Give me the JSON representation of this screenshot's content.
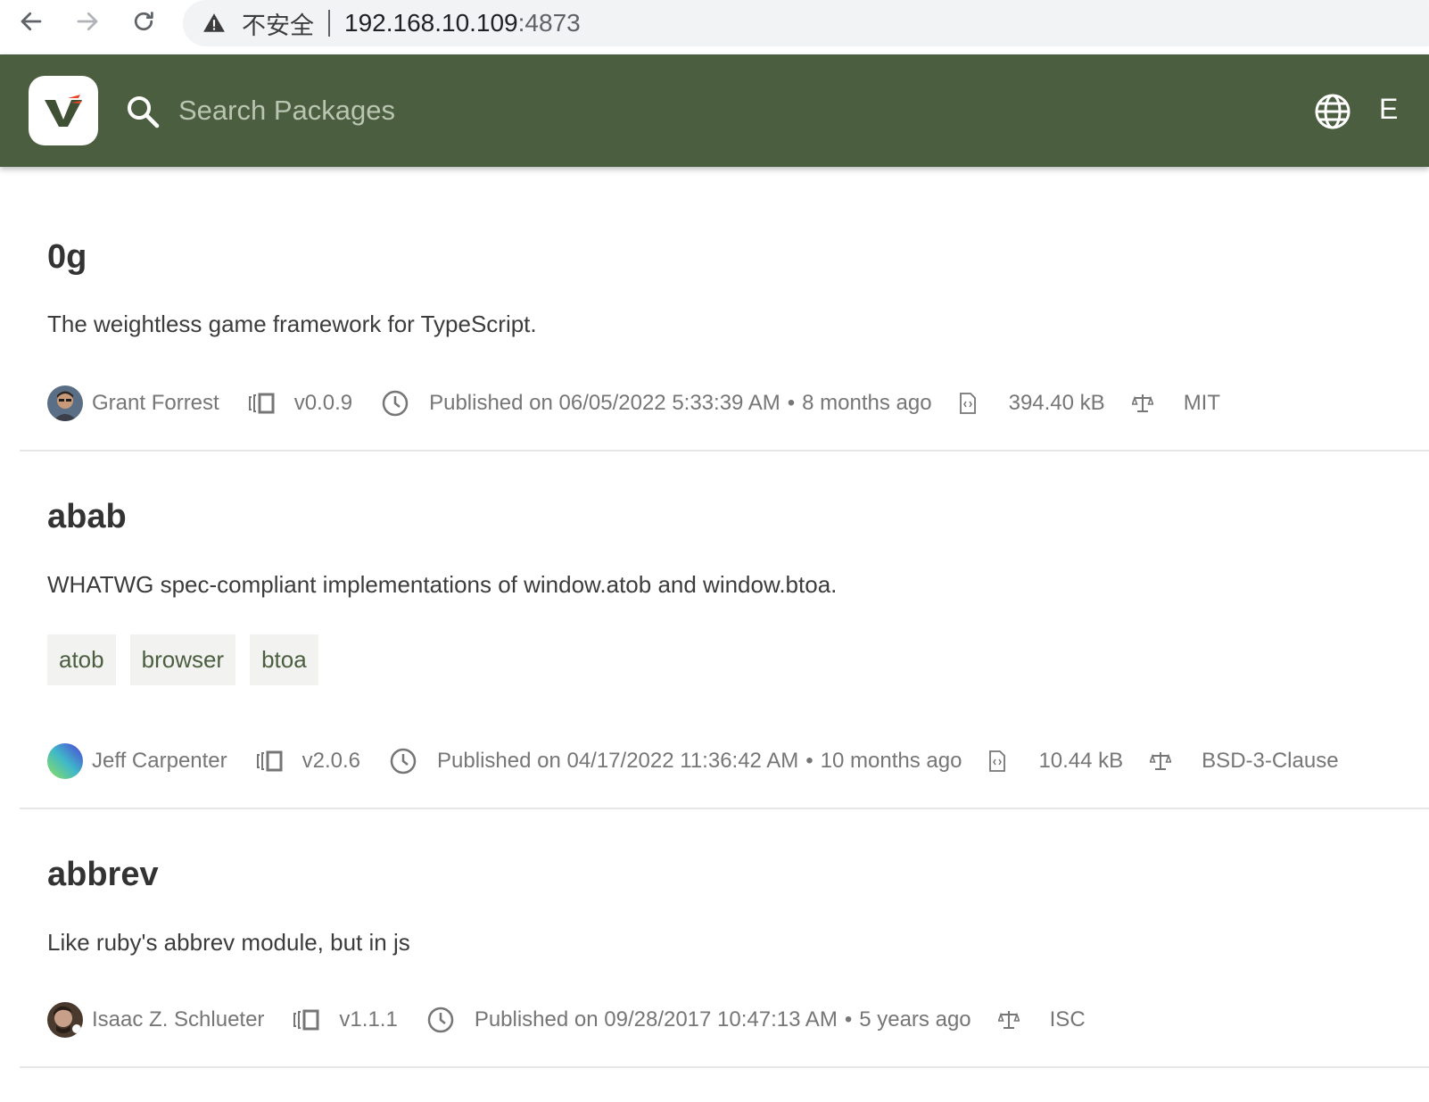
{
  "browser": {
    "insecure_label": "不安全",
    "url_host": "192.168.10.109",
    "url_port": ":4873"
  },
  "header": {
    "search_placeholder": "Search Packages",
    "lang_label": "E",
    "brand_color": "#4b5e40"
  },
  "packages": [
    {
      "name": "0g",
      "description": "The weightless game framework for TypeScript.",
      "tags": [],
      "author": "Grant Forrest",
      "version": "v0.0.9",
      "published": "Published on 06/05/2022 5:33:39 AM",
      "dot": "•",
      "ago": "8 months ago",
      "size": "394.40 kB",
      "license": "MIT"
    },
    {
      "name": "abab",
      "description": "WHATWG spec-compliant implementations of window.atob and window.btoa.",
      "tags": [
        "atob",
        "browser",
        "btoa"
      ],
      "author": "Jeff Carpenter",
      "version": "v2.0.6",
      "published": "Published on 04/17/2022 11:36:42 AM",
      "dot": "•",
      "ago": "10 months ago",
      "size": "10.44 kB",
      "license": "BSD-3-Clause"
    },
    {
      "name": "abbrev",
      "description": "Like ruby's abbrev module, but in js",
      "tags": [],
      "author": "Isaac Z. Schlueter",
      "version": "v1.1.1",
      "published": "Published on 09/28/2017 10:47:13 AM",
      "dot": "•",
      "ago": "5 years ago",
      "license": "ISC"
    }
  ]
}
